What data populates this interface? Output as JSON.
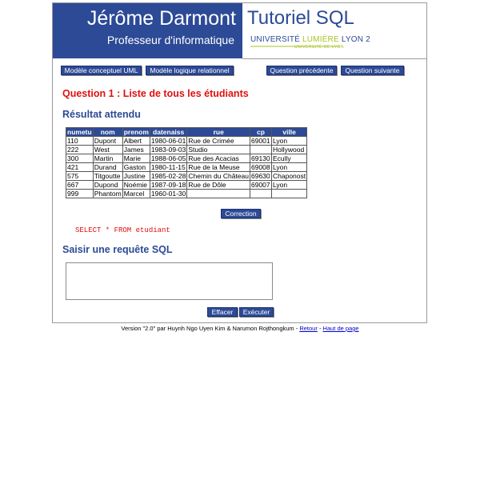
{
  "header": {
    "author_name": "Jérôme Darmont",
    "author_role": "Professeur d'informatique",
    "site_title": "Tutoriel SQL",
    "university": {
      "part1": "UNIVERSITÉ ",
      "part2": "LUMIÈRE",
      "part3": " LYON 2",
      "subtitle": "UNIVERSITÉ DE LYON"
    }
  },
  "nav": {
    "model_uml": "Modèle conceptuel UML",
    "model_relational": "Modèle logique relationnel",
    "prev_question": "Question précédente",
    "next_question": "Question suivante"
  },
  "question": {
    "title": "Question 1 : Liste de tous les étudiants"
  },
  "expected": {
    "heading": "Résultat attendu",
    "columns": [
      "numetu",
      "nom",
      "prenom",
      "datenaiss",
      "rue",
      "cp",
      "ville"
    ],
    "rows": [
      [
        "110",
        "Dupont",
        "Albert",
        "1980-06-01",
        "Rue de Crimée",
        "69001",
        "Lyon"
      ],
      [
        "222",
        "West",
        "James",
        "1983-09-03",
        "Studio",
        "",
        "Hollywood"
      ],
      [
        "300",
        "Martin",
        "Marie",
        "1988-06-05",
        "Rue des Acacias",
        "69130",
        "Ecully"
      ],
      [
        "421",
        "Durand",
        "Gaston",
        "1980-11-15",
        "Rue de la Meuse",
        "69008",
        "Lyon"
      ],
      [
        "575",
        "Titgoutte",
        "Justine",
        "1985-02-28",
        "Chemin du Château",
        "69630",
        "Chaponost"
      ],
      [
        "667",
        "Dupond",
        "Noémie",
        "1987-09-18",
        "Rue de Dôle",
        "69007",
        "Lyon"
      ],
      [
        "999",
        "Phantom",
        "Marcel",
        "1960-01-30",
        "",
        "",
        ""
      ]
    ]
  },
  "correction": {
    "button": "Correction",
    "query": "SELECT * FROM etudiant"
  },
  "input": {
    "heading": "Saisir une requête SQL",
    "value": "",
    "clear_button": "Effacer",
    "run_button": "Exécuter"
  },
  "footer": {
    "text": "Version \"2.0\" par Huynh Ngo Uyen Kim & Narumon Rojthongkum - ",
    "back_link": "Retour",
    "sep": " - ",
    "top_link": "Haut de page"
  },
  "colors": {
    "brand": "#2c4a96",
    "accent": "#e01010",
    "logo_green": "#a7c224"
  }
}
